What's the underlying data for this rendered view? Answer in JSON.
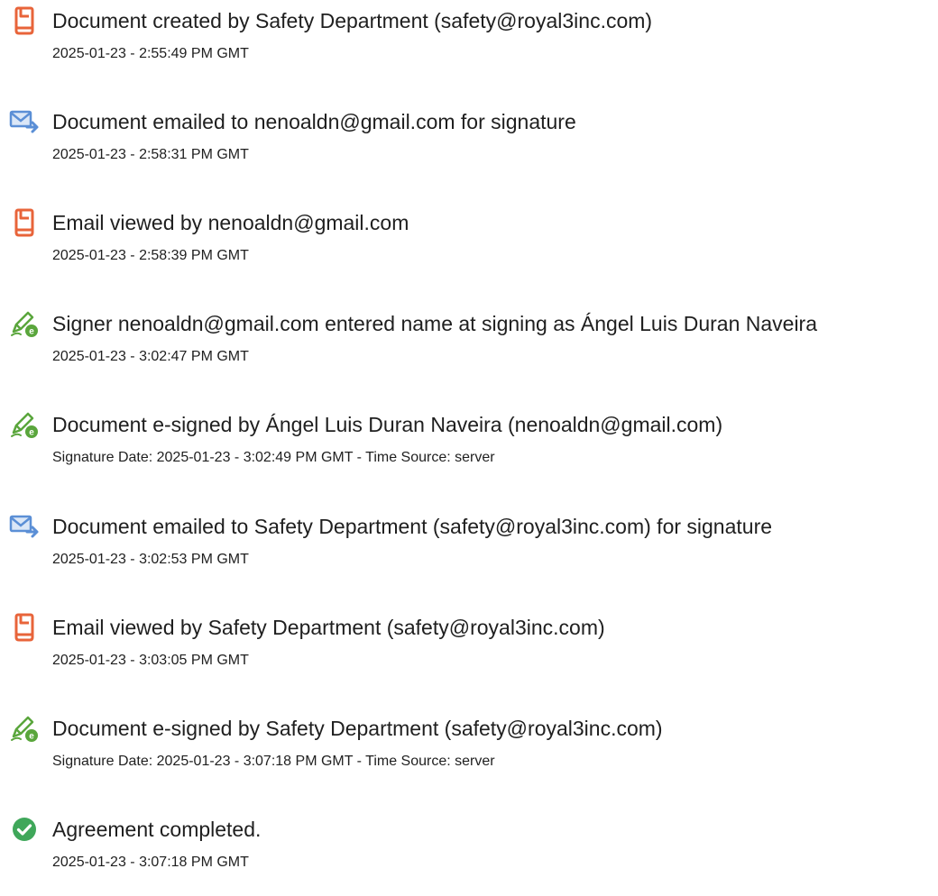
{
  "audit_events": [
    {
      "icon": "document-created-icon",
      "title": "Document created by Safety Department (safety@royal3inc.com)",
      "time": "2025-01-23 - 2:55:49 PM GMT"
    },
    {
      "icon": "email-sent-icon",
      "title": "Document emailed to nenoaldn@gmail.com for signature",
      "time": "2025-01-23 - 2:58:31 PM GMT"
    },
    {
      "icon": "document-viewed-icon",
      "title": "Email viewed by nenoaldn@gmail.com",
      "time": "2025-01-23 - 2:58:39 PM GMT"
    },
    {
      "icon": "e-sign-pen-icon",
      "title": "Signer nenoaldn@gmail.com entered name at signing as Ángel Luis Duran Naveira",
      "time": "2025-01-23 - 3:02:47 PM GMT"
    },
    {
      "icon": "e-sign-pen-icon",
      "title": "Document e-signed by Ángel Luis Duran Naveira (nenoaldn@gmail.com)",
      "time": "Signature Date: 2025-01-23 - 3:02:49 PM GMT - Time Source: server"
    },
    {
      "icon": "email-sent-icon",
      "title": "Document emailed to Safety Department (safety@royal3inc.com) for signature",
      "time": "2025-01-23 - 3:02:53 PM GMT"
    },
    {
      "icon": "document-viewed-icon",
      "title": "Email viewed by Safety Department (safety@royal3inc.com)",
      "time": "2025-01-23 - 3:03:05 PM GMT"
    },
    {
      "icon": "e-sign-pen-icon",
      "title": "Document e-signed by Safety Department (safety@royal3inc.com)",
      "time": "Signature Date: 2025-01-23 - 3:07:18 PM GMT - Time Source: server"
    },
    {
      "icon": "checkmark-circle-icon",
      "title": "Agreement completed.",
      "time": "2025-01-23 - 3:07:18 PM GMT"
    }
  ],
  "colors": {
    "document_icon": "#e8643a",
    "email_icon": "#5b8fd6",
    "pen_icon": "#5aa63c",
    "check_icon": "#3fa75a"
  }
}
